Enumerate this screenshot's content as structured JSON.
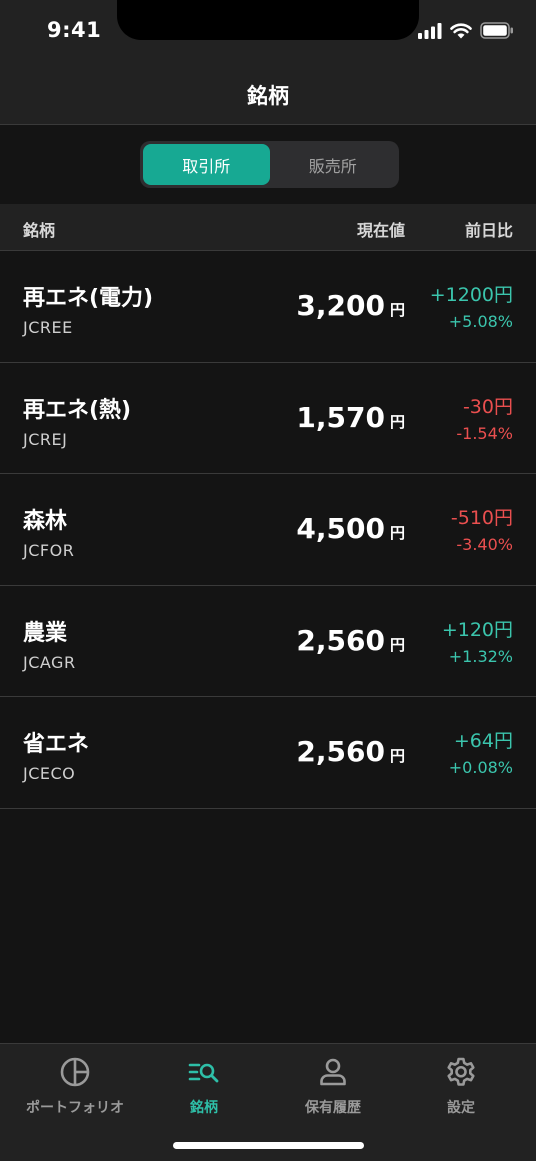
{
  "status_bar": {
    "time": "9:41"
  },
  "nav": {
    "title": "銘柄"
  },
  "segment": {
    "options": [
      "取引所",
      "販売所"
    ],
    "selected": "取引所"
  },
  "list_header": {
    "name": "銘柄",
    "price": "現在値",
    "change": "前日比"
  },
  "stocks": [
    {
      "name": "再エネ(電力)",
      "code": "JCREE",
      "price": "3,200",
      "unit": "円",
      "change": "+1200円",
      "change_pct": "+5.08%",
      "direction": "up"
    },
    {
      "name": "再エネ(熱)",
      "code": "JCREJ",
      "price": "1,570",
      "unit": "円",
      "change": "-30円",
      "change_pct": "-1.54%",
      "direction": "down"
    },
    {
      "name": "森林",
      "code": "JCFOR",
      "price": "4,500",
      "unit": "円",
      "change": "-510円",
      "change_pct": "-3.40%",
      "direction": "down"
    },
    {
      "name": "農業",
      "code": "JCAGR",
      "price": "2,560",
      "unit": "円",
      "change": "+120円",
      "change_pct": "+1.32%",
      "direction": "up"
    },
    {
      "name": "省エネ",
      "code": "JCECO",
      "price": "2,560",
      "unit": "円",
      "change": "+64円",
      "change_pct": "+0.08%",
      "direction": "up"
    }
  ],
  "tabs": [
    {
      "label": "ポートフォリオ",
      "icon": "pie-chart-icon",
      "active": false
    },
    {
      "label": "銘柄",
      "icon": "list-search-icon",
      "active": true
    },
    {
      "label": "保有履歴",
      "icon": "person-icon",
      "active": false
    },
    {
      "label": "設定",
      "icon": "gear-icon",
      "active": false
    }
  ],
  "colors": {
    "accent": "#17a993",
    "up": "#3bc5ad",
    "down": "#ea4f4f"
  }
}
